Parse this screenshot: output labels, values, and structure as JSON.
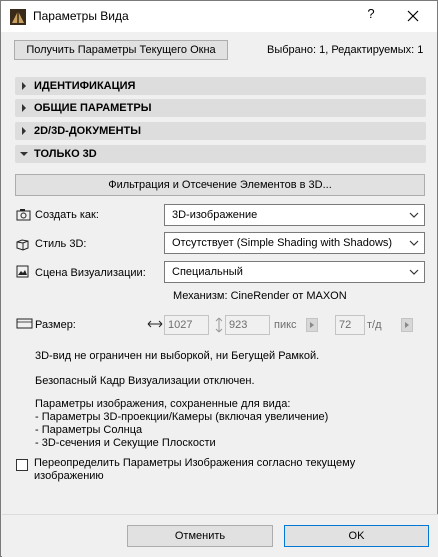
{
  "window": {
    "title": "Параметры Вида",
    "help_label": "?",
    "close_icon": "close-icon",
    "app_icon": "archicad-icon"
  },
  "top": {
    "get_params_button": "Получить Параметры Текущего Окна",
    "selection_status": "Выбрано: 1, Редактируемых: 1"
  },
  "sections": [
    {
      "label": "ИДЕНТИФИКАЦИЯ",
      "expanded": false
    },
    {
      "label": "ОБЩИЕ ПАРАМЕТРЫ",
      "expanded": false
    },
    {
      "label": "2D/3D-ДОКУМЕНТЫ",
      "expanded": false
    },
    {
      "label": "ТОЛЬКО 3D",
      "expanded": true
    }
  ],
  "only3d": {
    "filter_button": "Фильтрация и Отсечение Элементов в 3D...",
    "create_as_label": "Создать как:",
    "create_as_value": "3D-изображение",
    "style_label": "Стиль 3D:",
    "style_value": "Отсутствует (Simple Shading with Shadows)",
    "scene_label": "Сцена Визуализации:",
    "scene_value": "Специальный",
    "engine_text": "Механизм: CineRender от MAXON",
    "size_label": "Размер:",
    "width_value": "1027",
    "height_value": "923",
    "size_unit": "пикс",
    "resolution_value": "72",
    "resolution_unit": "т/д",
    "info_marquee": "3D-вид не ограничен ни выборкой, ни Бегущей Рамкой.",
    "info_safe_frame": "Безопасный Кадр Визуализации отключен.",
    "saved_params_title": "Параметры изображения, сохраненные для вида:",
    "saved_params_1": "- Параметры 3D-проекции/Камеры (включая увеличение)",
    "saved_params_2": "- Параметры Солнца",
    "saved_params_3": "- 3D-сечения и Секущие Плоскости",
    "override_label_1": "Переопределить Параметры Изображения согласно текущему",
    "override_label_2": "изображению",
    "override_checked": false
  },
  "footer": {
    "cancel_label": "Отменить",
    "ok_label": "OK"
  },
  "colors": {
    "accent_border": "#0078d7",
    "section_bg": "#dddddd",
    "window_bg": "#f0f0f0"
  }
}
